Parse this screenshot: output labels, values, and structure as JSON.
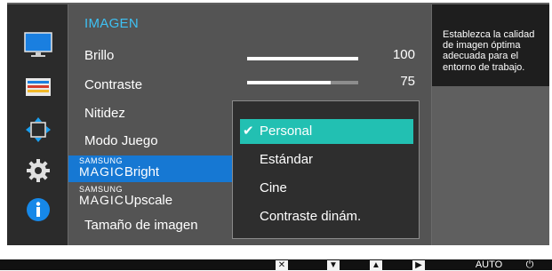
{
  "menu": {
    "title": "IMAGEN",
    "items": [
      {
        "label": "Brillo",
        "value": "100",
        "level": 100
      },
      {
        "label": "Contraste",
        "value": "75",
        "level": 75
      },
      {
        "label": "Nitidez"
      },
      {
        "label": "Modo Juego"
      },
      {
        "prefix_small": "SAMSUNG",
        "prefix_magic": "MAGIC",
        "label": "Bright"
      },
      {
        "prefix_small": "SAMSUNG",
        "prefix_magic": "MAGIC",
        "label": "Upscale"
      },
      {
        "label": "Tamaño de imagen"
      }
    ]
  },
  "submenu": {
    "options": [
      "Personal",
      "Estándar",
      "Cine",
      "Contraste dinám."
    ],
    "selected_check": "✔"
  },
  "help": {
    "text": "Establezca la calidad de imagen óptima adecuada para el entorno de trabajo."
  },
  "footer": {
    "buttons": [
      "✕",
      "▼",
      "▲",
      "▶",
      "AUTO",
      "⏻"
    ]
  },
  "colors": {
    "accent_title": "#3ec1f3",
    "selected_row": "#1678d3",
    "selected_option": "#22c0b2",
    "info_icon": "#1688e8"
  },
  "icons": [
    "monitor-icon",
    "picture-settings-icon",
    "resize-arrows-icon",
    "gear-icon",
    "info-icon"
  ]
}
